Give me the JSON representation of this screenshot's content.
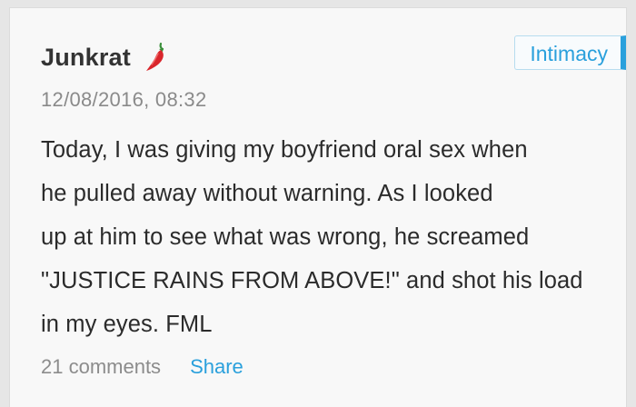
{
  "post": {
    "author": "Junkrat",
    "author_icon": "chili-pepper-icon",
    "date": "12/08/2016, 08:32",
    "category": "Intimacy",
    "story_lines": [
      "Today, I was giving my boyfriend oral sex when",
      "he pulled away without warning. As I looked",
      "up at him to see what was wrong, he screamed",
      "\"JUSTICE RAINS FROM ABOVE!\" and shot his load",
      "in my eyes. FML"
    ],
    "comments_label": "21 comments",
    "share_label": "Share"
  },
  "colors": {
    "accent": "#2aa0dc",
    "card_bg": "#f8f8f8",
    "page_bg": "#e6e6e6",
    "text": "#2b2b2b",
    "muted": "#8a8a8a",
    "chili": "#d9262c"
  }
}
